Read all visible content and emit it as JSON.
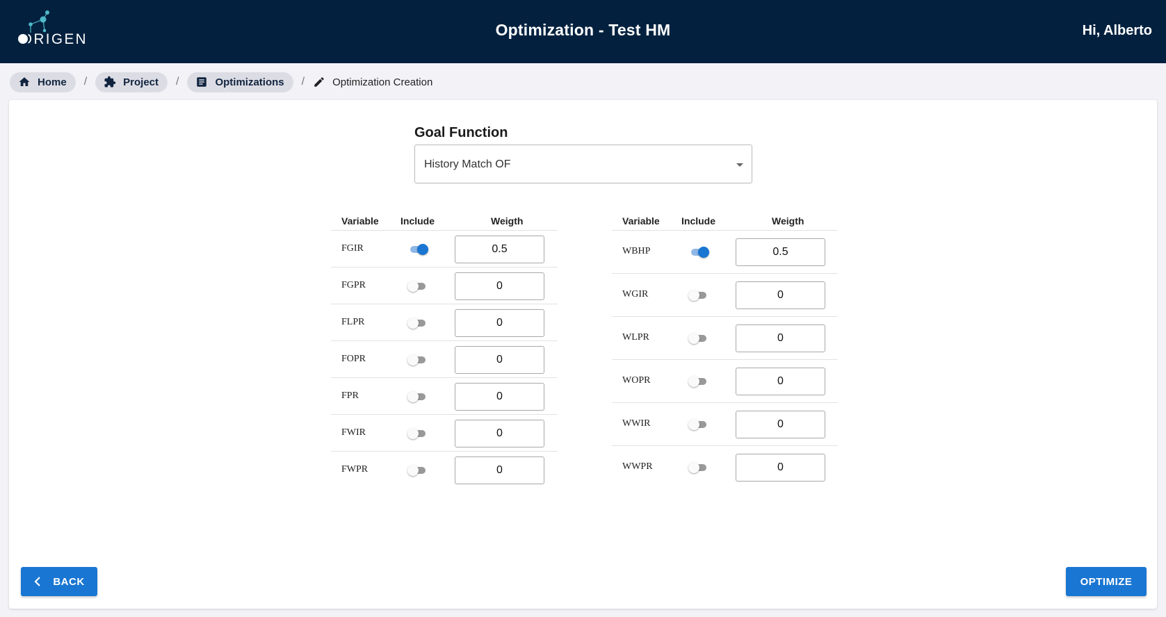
{
  "header": {
    "logo_text": "ORIGEN",
    "title": "Optimization - Test HM",
    "greeting": "Hi, Alberto"
  },
  "breadcrumb": {
    "items": [
      {
        "label": "Home",
        "icon": "home-icon"
      },
      {
        "label": "Project",
        "icon": "puzzle-icon"
      },
      {
        "label": "Optimizations",
        "icon": "document-icon"
      }
    ],
    "separator": "/",
    "current": {
      "label": "Optimization Creation",
      "icon": "pencil-icon"
    }
  },
  "goal": {
    "label": "Goal Function",
    "selected": "History Match OF"
  },
  "columns": {
    "variable": "Variable",
    "include": "Include",
    "weight": "Weigth"
  },
  "field_variables": [
    {
      "name": "FGIR",
      "include": true,
      "weight": "0.5"
    },
    {
      "name": "FGPR",
      "include": false,
      "weight": "0"
    },
    {
      "name": "FLPR",
      "include": false,
      "weight": "0"
    },
    {
      "name": "FOPR",
      "include": false,
      "weight": "0"
    },
    {
      "name": "FPR",
      "include": false,
      "weight": "0"
    },
    {
      "name": "FWIR",
      "include": false,
      "weight": "0"
    },
    {
      "name": "FWPR",
      "include": false,
      "weight": "0"
    }
  ],
  "well_variables": [
    {
      "name": "WBHP",
      "include": true,
      "weight": "0.5"
    },
    {
      "name": "WGIR",
      "include": false,
      "weight": "0"
    },
    {
      "name": "WLPR",
      "include": false,
      "weight": "0"
    },
    {
      "name": "WOPR",
      "include": false,
      "weight": "0"
    },
    {
      "name": "WWIR",
      "include": false,
      "weight": "0"
    },
    {
      "name": "WWPR",
      "include": false,
      "weight": "0"
    }
  ],
  "actions": {
    "back": "BACK",
    "optimize": "OPTIMIZE"
  },
  "colors": {
    "header_bg": "#03213f",
    "accent": "#1976d2",
    "logo_teal": "#4fb8c9"
  }
}
